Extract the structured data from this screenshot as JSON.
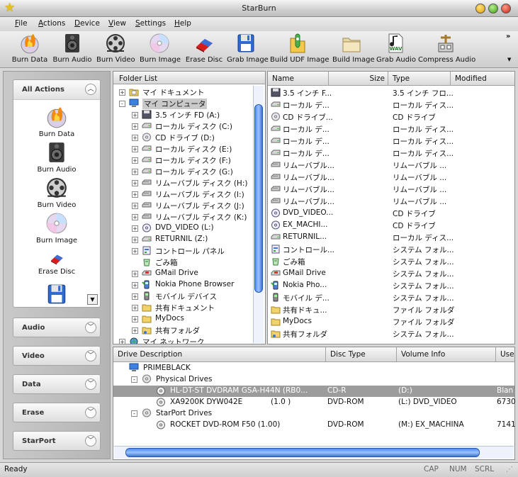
{
  "window": {
    "title": "StarBurn"
  },
  "menu": [
    "File",
    "Actions",
    "Device",
    "View",
    "Settings",
    "Help"
  ],
  "toolbar": {
    "buttons": [
      {
        "label": "Burn Data",
        "icon": "burn-data-icon"
      },
      {
        "label": "Burn Audio",
        "icon": "burn-audio-icon"
      },
      {
        "label": "Burn Video",
        "icon": "burn-video-icon"
      },
      {
        "label": "Burn Image",
        "icon": "burn-image-icon"
      },
      {
        "label": "Erase Disc",
        "icon": "erase-disc-icon"
      },
      {
        "label": "Grab Image",
        "icon": "grab-image-icon"
      },
      {
        "label": "Build UDF Image",
        "icon": "build-udf-image-icon"
      },
      {
        "label": "Build Image",
        "icon": "build-image-icon"
      },
      {
        "label": "Grab Audio",
        "icon": "grab-audio-icon"
      },
      {
        "label": "Compress Audio",
        "icon": "compress-audio-icon"
      }
    ],
    "wav_badge": "WAV"
  },
  "sidebar": {
    "all_actions": {
      "title": "All Actions",
      "items": [
        {
          "label": "Burn Data"
        },
        {
          "label": "Burn Audio"
        },
        {
          "label": "Burn Video"
        },
        {
          "label": "Burn Image"
        },
        {
          "label": "Erase Disc"
        },
        {
          "label": ""
        }
      ]
    },
    "categories": [
      "Audio",
      "Video",
      "Data",
      "Erase",
      "StarPort"
    ]
  },
  "folder_list": {
    "header": "Folder List",
    "items": [
      {
        "label": "マイ ドキュメント",
        "level": 0,
        "expander": "+",
        "icon": "my-documents-icon"
      },
      {
        "label": "マイ コンピュータ",
        "level": 0,
        "expander": "-",
        "icon": "my-computer-icon",
        "selected": true
      },
      {
        "label": "3.5 インチ FD (A:)",
        "level": 1,
        "expander": "+",
        "icon": "floppy-drive-icon"
      },
      {
        "label": "ローカル ディスク (C:)",
        "level": 1,
        "expander": "+",
        "icon": "local-disk-icon"
      },
      {
        "label": "CD ドライブ (D:)",
        "level": 1,
        "expander": "+",
        "icon": "cd-drive-icon"
      },
      {
        "label": "ローカル ディスク (E:)",
        "level": 1,
        "expander": "+",
        "icon": "local-disk-icon"
      },
      {
        "label": "ローカル ディスク (F:)",
        "level": 1,
        "expander": "+",
        "icon": "local-disk-icon"
      },
      {
        "label": "ローカル ディスク (G:)",
        "level": 1,
        "expander": "+",
        "icon": "local-disk-icon"
      },
      {
        "label": "リムーバブル ディスク (H:)",
        "level": 1,
        "expander": "+",
        "icon": "removable-disk-icon"
      },
      {
        "label": "リムーバブル ディスク (I:)",
        "level": 1,
        "expander": "+",
        "icon": "removable-disk-icon"
      },
      {
        "label": "リムーバブル ディスク (J:)",
        "level": 1,
        "expander": "+",
        "icon": "removable-disk-icon"
      },
      {
        "label": "リムーバブル ディスク (K:)",
        "level": 1,
        "expander": "+",
        "icon": "removable-disk-icon"
      },
      {
        "label": "DVD_VIDEO (L:)",
        "level": 1,
        "expander": "+",
        "icon": "dvd-drive-icon"
      },
      {
        "label": "RETURNIL (Z:)",
        "level": 1,
        "expander": "+",
        "icon": "local-disk-icon"
      },
      {
        "label": "コントロール パネル",
        "level": 1,
        "expander": "+",
        "icon": "control-panel-icon"
      },
      {
        "label": "ごみ箱",
        "level": 1,
        "expander": "",
        "icon": "recycle-bin-icon"
      },
      {
        "label": "GMail Drive",
        "level": 1,
        "expander": "+",
        "icon": "gmail-drive-icon"
      },
      {
        "label": "Nokia Phone Browser",
        "level": 1,
        "expander": "+",
        "icon": "phone-browser-icon"
      },
      {
        "label": "モバイル デバイス",
        "level": 1,
        "expander": "+",
        "icon": "mobile-device-icon"
      },
      {
        "label": "共有ドキュメント",
        "level": 1,
        "expander": "+",
        "icon": "folder-icon"
      },
      {
        "label": "MyDocs",
        "level": 1,
        "expander": "+",
        "icon": "folder-icon"
      },
      {
        "label": "共有フォルダ",
        "level": 1,
        "expander": "+",
        "icon": "shared-folder-icon"
      },
      {
        "label": "マイ ネットワーク",
        "level": 0,
        "expander": "+",
        "icon": "network-icon"
      }
    ]
  },
  "file_list": {
    "columns": [
      "Name",
      "Size",
      "Type",
      "Modified"
    ],
    "rows": [
      {
        "name": "3.5 インチ F...",
        "type": "3.5 インチ フロ...",
        "icon": "floppy-drive-icon"
      },
      {
        "name": "ローカル デ...",
        "type": "ローカル ディス...",
        "icon": "local-disk-icon"
      },
      {
        "name": "CD ドライブ...",
        "type": "CD ドライブ",
        "icon": "cd-drive-icon"
      },
      {
        "name": "ローカル デ...",
        "type": "ローカル ディス...",
        "icon": "local-disk-icon"
      },
      {
        "name": "ローカル デ...",
        "type": "ローカル ディス...",
        "icon": "local-disk-icon"
      },
      {
        "name": "ローカル デ...",
        "type": "ローカル ディス...",
        "icon": "local-disk-icon"
      },
      {
        "name": "リムーバブル...",
        "type": "リムーバブル ...",
        "icon": "removable-disk-icon"
      },
      {
        "name": "リムーバブル...",
        "type": "リムーバブル ...",
        "icon": "removable-disk-icon"
      },
      {
        "name": "リムーバブル...",
        "type": "リムーバブル ...",
        "icon": "removable-disk-icon"
      },
      {
        "name": "リムーバブル...",
        "type": "リムーバブル ...",
        "icon": "removable-disk-icon"
      },
      {
        "name": "DVD_VIDEO...",
        "type": "CD ドライブ",
        "icon": "dvd-drive-icon"
      },
      {
        "name": "EX_MACHI...",
        "type": "CD ドライブ",
        "icon": "dvd-drive-icon"
      },
      {
        "name": "RETURNIL...",
        "type": "ローカル ディス...",
        "icon": "local-disk-icon"
      },
      {
        "name": "コントロール...",
        "type": "システム フォル...",
        "icon": "control-panel-icon"
      },
      {
        "name": "ごみ箱",
        "type": "システム フォル...",
        "icon": "recycle-bin-icon"
      },
      {
        "name": "GMail Drive",
        "type": "システム フォル...",
        "icon": "gmail-drive-icon"
      },
      {
        "name": "Nokia Pho...",
        "type": "システム フォル...",
        "icon": "phone-browser-icon"
      },
      {
        "name": "モバイル デ...",
        "type": "システム フォル...",
        "icon": "mobile-device-icon"
      },
      {
        "name": "共有ドキュ...",
        "type": "ファイル フォルダ",
        "icon": "folder-icon"
      },
      {
        "name": "MyDocs",
        "type": "ファイル フォルダ",
        "icon": "folder-icon"
      },
      {
        "name": "共有フォルダ",
        "type": "システム フォル...",
        "icon": "shared-folder-icon"
      }
    ]
  },
  "drives": {
    "columns": [
      "Drive Description",
      "Disc Type",
      "Volume Info",
      "Use"
    ],
    "root": "PRIMEBLACK",
    "groups": [
      {
        "label": "Physical Drives",
        "drives": [
          {
            "description": "HL-DT-ST DVDRAM GSA-H44N  (RB0...",
            "disc_type": "CD-R",
            "volume": "(D:)",
            "use": "Blan",
            "selected": true
          },
          {
            "description": "XA9200K  DYW042E",
            "extra": "(1.0 )",
            "disc_type": "DVD-ROM",
            "volume": "(L:) DVD_VIDEO",
            "use": "6730"
          }
        ]
      },
      {
        "label": "StarPort Drives",
        "drives": [
          {
            "description": "ROCKET DVD-ROM F50 (1.00)",
            "disc_type": "DVD-ROM",
            "volume": "(M:) EX_MACHINA",
            "use": "7141"
          }
        ]
      }
    ]
  },
  "status": {
    "left": "Ready",
    "indicators": [
      "CAP",
      "NUM",
      "SCRL"
    ]
  },
  "colors": {
    "selection": "#9c9c9c",
    "scroll_thumb": "#4f8cf0",
    "accent": "#e7c21d"
  }
}
